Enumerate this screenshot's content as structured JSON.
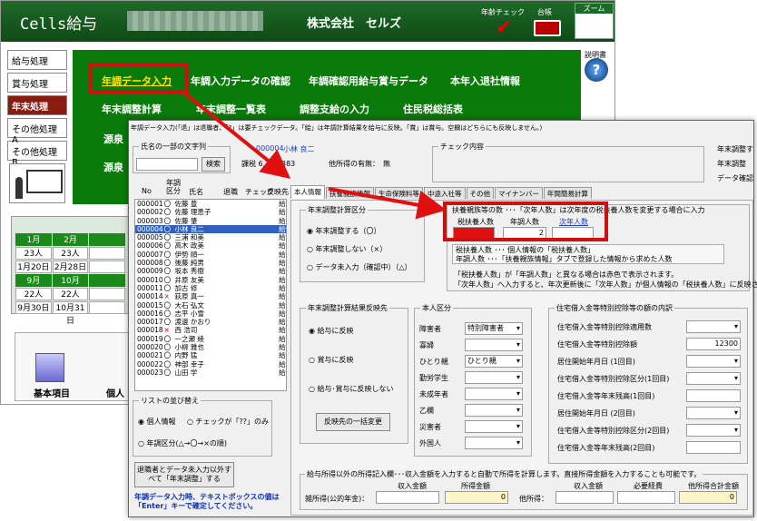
{
  "bg": {
    "app_title": "Cells給与",
    "company": "株式会社　セルズ",
    "nenrei_check": "年齢チェック",
    "daichou": "台帳",
    "zoom": "ズーム",
    "setsumeisho": "説明書",
    "left_menu": [
      "給与処理",
      "賞与処理",
      "年末処理",
      "その他処理 A",
      "その他処理 B"
    ],
    "green_menu": {
      "row1": [
        "年調データ入力",
        "年調入力データの確認",
        "年調確認用給与賞与データ",
        "本年入退社情報"
      ],
      "row2": [
        "年末調整計算",
        "年末調整一覧表",
        "調整支給の入力",
        "住民税総括表"
      ],
      "row3": "源泉",
      "row4": "源泉"
    },
    "calendar": {
      "r1": [
        "1月",
        "2月"
      ],
      "r2": [
        "23人",
        "23人"
      ],
      "r3": [
        "1月20日",
        "2月28日"
      ],
      "r4": [
        "9月",
        "10月"
      ],
      "r5": [
        "22人",
        "22人"
      ],
      "r6": [
        "9月30日",
        "10月31日"
      ]
    },
    "icons": {
      "kihon": "基本項目",
      "ko": "個人"
    }
  },
  "dlg": {
    "header": "年調データ入力(「退」は退職者、「?」は要チェックデータ。「給」は年調計算結果を給与に反映。「賞」は賞与。空欄はどちらにも反映しません。)",
    "name_group": "氏名の一部の文字列",
    "search_btn": "検索",
    "emp_code": "000004",
    "emp_name": "小林 良二",
    "taxable": "課税 6,356,383",
    "other_income": "他所得の有無：　無",
    "check_content": "チェック内容",
    "right_labels": [
      "年末調整す",
      "年末調整",
      "データ確認"
    ],
    "list_headers": [
      "No",
      "年調区分",
      "氏名",
      "退職",
      "チェック",
      "反映先"
    ],
    "tabs": [
      "本人情報",
      "扶養親族情報",
      "生命保険料等",
      "中途入社等",
      "その他",
      "マイナンバー",
      "年間簡易計算"
    ],
    "employees": [
      [
        "000001",
        "〇",
        "佐藤 豊",
        "",
        "給"
      ],
      [
        "000002",
        "〇",
        "佐藤 理恵子",
        "",
        "給"
      ],
      [
        "000003",
        "〇",
        "佐藤 肇",
        "",
        "給"
      ],
      [
        "000004",
        "〇",
        "小林 良二",
        "",
        "給"
      ],
      [
        "000005",
        "〇",
        "三浦 和美",
        "",
        "給"
      ],
      [
        "000006",
        "〇",
        "高木 政美",
        "",
        "給"
      ],
      [
        "000007",
        "〇",
        "伊勢 順一",
        "",
        "給"
      ],
      [
        "000008",
        "〇",
        "後藤 純男",
        "",
        "給"
      ],
      [
        "000009",
        "〇",
        "坂本 秀樹",
        "",
        "給"
      ],
      [
        "000010",
        "〇",
        "井原 友美",
        "",
        "給"
      ],
      [
        "000011",
        "〇",
        "加古 修",
        "",
        "給"
      ],
      [
        "000014",
        "×",
        "荻原 真一",
        "",
        "給"
      ],
      [
        "000015",
        "〇",
        "大石 弘文",
        "",
        "給"
      ],
      [
        "000016",
        "〇",
        "志平 小雪",
        "",
        "給"
      ],
      [
        "000017",
        "〇",
        "渡邊 かおり",
        "",
        "給"
      ],
      [
        "000018",
        "×",
        "西 浩司",
        "",
        "給"
      ],
      [
        "000019",
        "〇",
        "一之瀬 綾",
        "",
        "給"
      ],
      [
        "000020",
        "〇",
        "小柳 雅也",
        "",
        "給"
      ],
      [
        "000021",
        "〇",
        "内野 猛",
        "",
        "給"
      ],
      [
        "000022",
        "〇",
        "神部 幸子",
        "",
        "給"
      ],
      [
        "000023",
        "〇",
        "山田 学",
        "",
        "給"
      ]
    ],
    "sort_group": "リストの並び替え",
    "sort_opts": [
      "個人情報",
      "チェックが「??」のみ",
      "年調区分(△→〇→×の順)"
    ],
    "bottom_btn": "退職者とデータ未入力以外すべて「年末調整」する",
    "bottom_note": "年調データ入力時、テキストボックスの値は「Enter」キーで確定してください。",
    "nencho_group": "年末調整計算区分",
    "nencho_opts": [
      "年末調整する（〇）",
      "年末調整しない（×）",
      "データ未入力（確認中）（△）"
    ],
    "fuyou_title": "扶養親族等の数 ･･･「次年人数」は次年度の税扶養人数を変更する場合に入力",
    "fuyou_heads": [
      "税扶養人数",
      "年調人数",
      "次年人数"
    ],
    "fuyou_vals": [
      "",
      "2",
      ""
    ],
    "fuyou_desc": [
      "税扶養人数 ･･･ 個人情報の「税扶養人数」",
      "年調人数 ･･･「扶養親族情報」タブで登録した情報から求めた人数"
    ],
    "fuyou_note1": "「税扶養人数」が「年調人数」と異なる場合は赤色で表示されます。",
    "fuyou_note2": "「次年人数」へ入力すると、年次更新後に「次年人数」が個人情報の「税扶養人数」に反映されます。",
    "hanei_group": "年末調整計算結果反映先",
    "hanei_opts": [
      "給与に反映",
      "賞与に反映",
      "給与･賞与に反映しない"
    ],
    "hanei_btn": "反映先の一括変更",
    "honnin_group": "本人区分",
    "honnin_labels": [
      "障害者",
      "寡婦",
      "ひとり親",
      "勤労学生",
      "未成年者",
      "乙欄",
      "災害者",
      "外国人"
    ],
    "honnin_vals": [
      "特別障害者",
      "",
      "ひとり親",
      "",
      "",
      "",
      "",
      ""
    ],
    "jutaku_group": "住宅借入金等特別控除等の額の内訳",
    "jutaku_labels": [
      "住宅借入金等特別控除適用数",
      "住宅借入金等特別控除額",
      "居住開始年月日 (1回目)",
      "住宅借入金等特別控除区分(1回目)",
      "住宅借入金等年末残高(1回目)",
      "居住開始年月日 (2回目)",
      "住宅借入金等特別控除区分(2回目)",
      "住宅借入金等年末残高(2回目)"
    ],
    "jutaku_amount": "12300",
    "other_title": "給与所得以外の所得記入欄･･･収入金額を入力すると自動で所得を計算します。直接所得金額を入力することも可能です。",
    "other_heads": [
      "収入金額",
      "所得金額",
      "収入金額",
      "必要経費",
      "他所得合計金額"
    ],
    "zatsu_label": "雑所得(公的年金)：",
    "ta_label": "他所得：",
    "zero": "0"
  }
}
